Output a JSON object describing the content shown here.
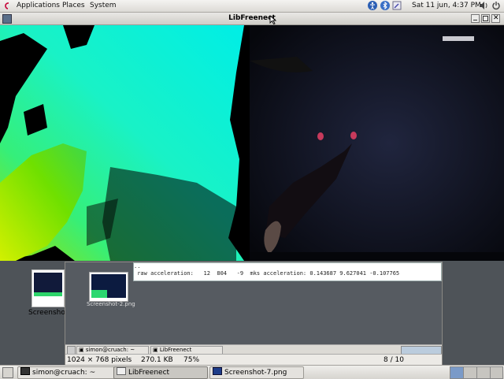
{
  "top_panel": {
    "menus": [
      "Applications",
      "Places",
      "System"
    ],
    "clock": "Sat 11 jun,  4:37 PM"
  },
  "window": {
    "title": "LibFreenect"
  },
  "desktop_icon": {
    "label": "Screensho"
  },
  "viewer": {
    "thumb_label": "Screenshot-2.png",
    "terminal_line_1": "..",
    "terminal_line_2": " raw acceleration:   12  804   -9  mks acceleration: 0.143687 9.627041 -0.107765",
    "inner_tasks": [
      "simon@cruach: ~",
      "LibFreenect"
    ],
    "status_dimensions": "1024 × 768 pixels",
    "status_size": "270.1 KB",
    "status_zoom": "75%",
    "status_index": "8 / 10"
  },
  "taskbar": {
    "items": [
      {
        "label": "simon@cruach: ~",
        "active": false
      },
      {
        "label": "LibFreenect",
        "active": true
      },
      {
        "label": "Screenshot-7.png",
        "active": false
      }
    ]
  },
  "colors": {
    "depth_near": "#7fe000",
    "depth_mid": "#2af5a8",
    "depth_far": "#00f0e8",
    "panel": "#dcdad5",
    "desktop": "#4e5358"
  }
}
